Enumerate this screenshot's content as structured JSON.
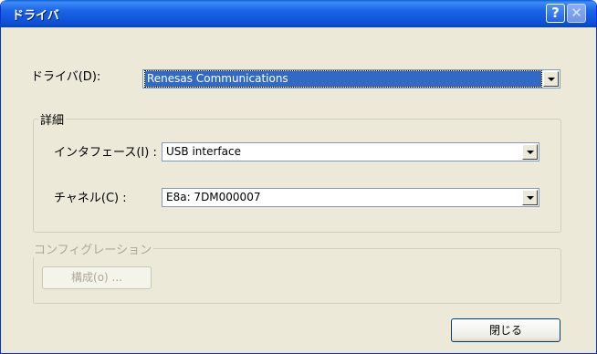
{
  "window": {
    "title": "ドライバ",
    "help_symbol": "?",
    "close_symbol": "✕"
  },
  "driver": {
    "label": "ドライバ(D):",
    "value": "Renesas Communications"
  },
  "details": {
    "group_label": "詳細",
    "interface_label": "インタフェース(I) :",
    "interface_value": "USB interface",
    "channel_label": "チャネル(C) :",
    "channel_value": "E8a: 7DM000007"
  },
  "configuration": {
    "group_label": "コンフィグレーション",
    "button_label": "構成(o) ..."
  },
  "footer": {
    "close_button_label": "閉じる"
  }
}
